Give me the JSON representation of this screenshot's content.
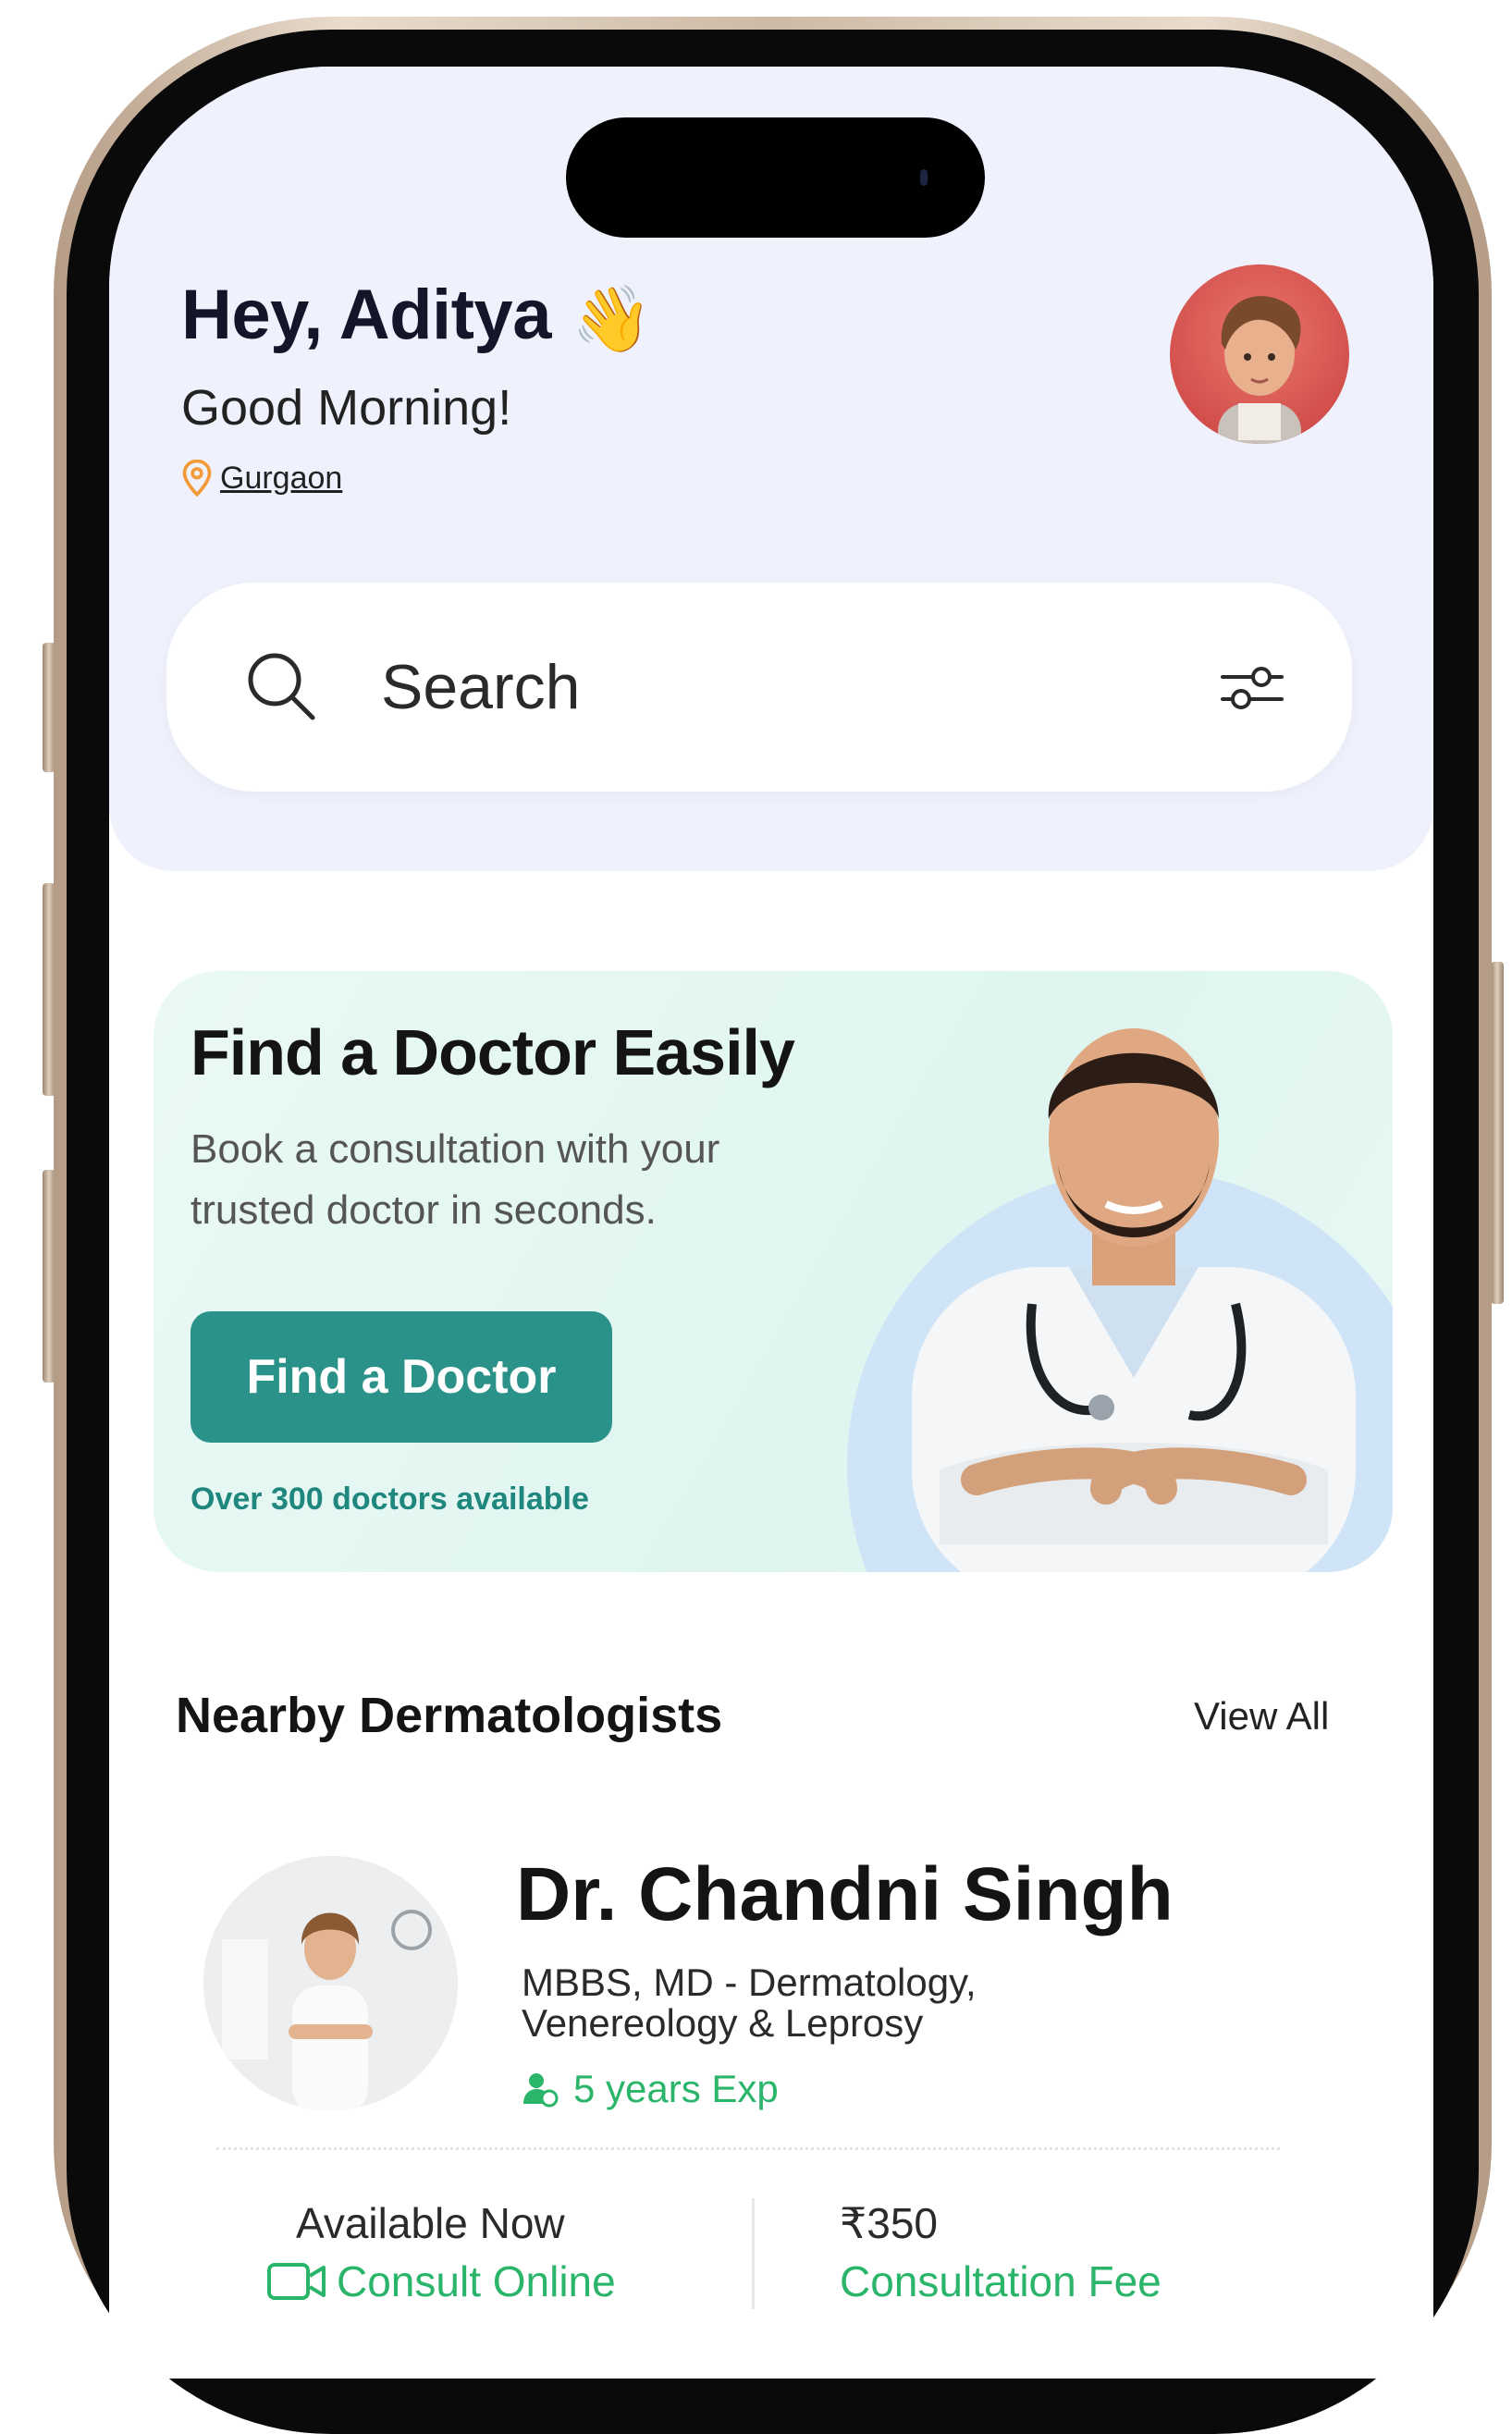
{
  "header": {
    "greeting": "Hey, Aditya",
    "subgreeting": "Good Morning!",
    "location": "Gurgaon"
  },
  "search": {
    "placeholder": "Search"
  },
  "banner": {
    "title": "Find a Doctor Easily",
    "subtitle": "Book a consultation with your trusted doctor in seconds.",
    "button_label": "Find a Doctor",
    "note": "Over 300 doctors available"
  },
  "nearby": {
    "title": "Nearby Dermatologists",
    "view_all": "View All"
  },
  "doctor": {
    "name": "Dr. Chandni Singh",
    "degree": "MBBS, MD - Dermatology, Venereology & Leprosy",
    "experience": "5 years Exp",
    "availability": "Available Now",
    "consult_mode": "Consult Online",
    "fee": "₹350",
    "fee_label": "Consultation Fee"
  },
  "colors": {
    "header_bg": "#eff1fd",
    "accent_teal": "#2a9288",
    "accent_green": "#2ab56a",
    "location_pin": "#f29a38"
  }
}
